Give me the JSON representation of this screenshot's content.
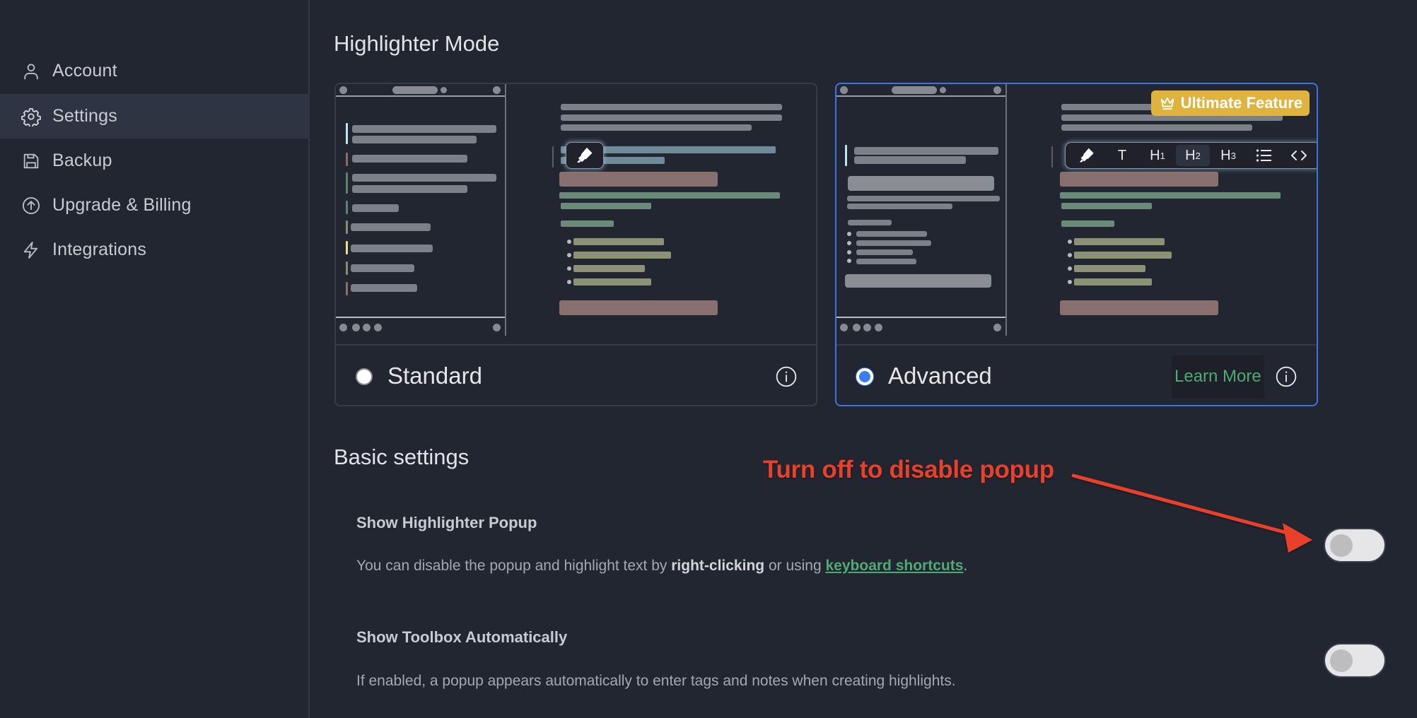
{
  "sidebar": {
    "items": [
      {
        "label": "Account",
        "icon": "user-icon",
        "active": false
      },
      {
        "label": "Settings",
        "icon": "gear-icon",
        "active": true
      },
      {
        "label": "Backup",
        "icon": "save-icon",
        "active": false
      },
      {
        "label": "Upgrade & Billing",
        "icon": "arrow-up-circle-icon",
        "active": false
      },
      {
        "label": "Integrations",
        "icon": "lightning-icon",
        "active": false
      }
    ]
  },
  "highlighter_mode": {
    "title": "Highlighter Mode",
    "options": [
      {
        "label": "Standard",
        "selected": false
      },
      {
        "label": "Advanced",
        "selected": true,
        "badge": "Ultimate Feature",
        "learn_more": "Learn More"
      }
    ],
    "toolbar_items": [
      "highlighter",
      "T",
      "H1",
      "H2",
      "H3",
      "list",
      "<>"
    ]
  },
  "basic_settings": {
    "title": "Basic settings",
    "items": [
      {
        "title": "Show Highlighter Popup",
        "desc_prefix": "You can disable the popup and highlight text by ",
        "desc_bold": "right-clicking",
        "desc_middle": " or using ",
        "desc_link": "keyboard shortcuts",
        "desc_suffix": ".",
        "enabled": false
      },
      {
        "title": "Show Toolbox Automatically",
        "desc": "If enabled, a popup appears automatically to enter tags and notes when creating highlights.",
        "enabled": false
      }
    ]
  },
  "annotation": {
    "text": "Turn off to disable popup",
    "color": "#e8412b"
  },
  "colors": {
    "background": "#222631",
    "accent_blue": "#3b74e0",
    "link_green": "#4faa73",
    "badge_gold": "#e0b33f"
  }
}
